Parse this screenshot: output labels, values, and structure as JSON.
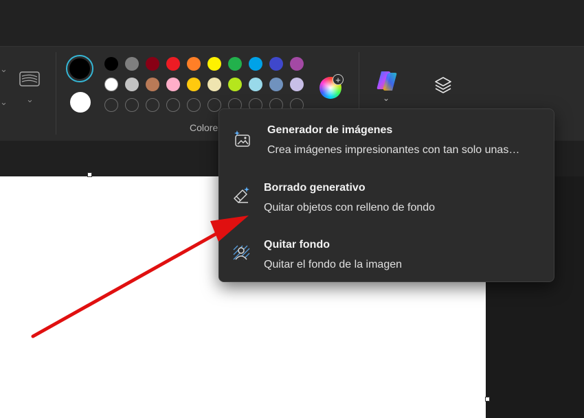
{
  "ribbon": {
    "colors_group_label": "Colore",
    "current_colors": {
      "foreground": "#000000",
      "background": "#ffffff"
    },
    "palette": [
      [
        "#000000",
        "#7f7f7f",
        "#880015",
        "#ed1c24",
        "#ff7f27",
        "#fff200",
        "#22b14c",
        "#00a2e8",
        "#3f48cc",
        "#a349a4"
      ],
      [
        "#ffffff",
        "#c3c3c3",
        "#b97a57",
        "#ffaec9",
        "#ffc90e",
        "#efe4b0",
        "#b5e61d",
        "#99d9ea",
        "#7092be",
        "#c8bfe7"
      ],
      [
        "",
        "",
        "",
        "",
        "",
        "",
        "",
        "",
        "",
        ""
      ]
    ],
    "icons": {
      "brushes": "brush-icon",
      "edit_colors": "color-wheel-icon",
      "copilot": "copilot-icon",
      "layers": "layers-icon"
    }
  },
  "menu": {
    "items": [
      {
        "title": "Generador de imágenes",
        "description": "Crea imágenes impresionantes con tan solo unas…",
        "icon": "image-sparkle-icon"
      },
      {
        "title": "Borrado generativo",
        "description": "Quitar objetos con relleno de fondo",
        "icon": "eraser-sparkle-icon"
      },
      {
        "title": "Quitar fondo",
        "description": "Quitar el fondo de la imagen",
        "icon": "remove-background-icon"
      }
    ]
  },
  "annotation": {
    "arrow_color": "#e01010"
  },
  "theme": {
    "accent": "#35b7d6",
    "menu_bg": "#2c2c2c",
    "ribbon_bg": "#2b2b2b"
  }
}
